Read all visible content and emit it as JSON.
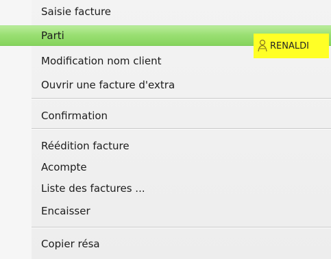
{
  "menu": {
    "items": [
      {
        "label": "Saisie facture"
      },
      {
        "label": "Parti"
      },
      {
        "label": "Modification nom client"
      },
      {
        "label": "Ouvrir une facture d'extra"
      },
      {
        "label": "Confirmation"
      },
      {
        "label": "Réédition facture"
      },
      {
        "label": "Acompte"
      },
      {
        "label": "Liste des factures ..."
      },
      {
        "label": "Encaisser"
      },
      {
        "label": "Copier résa"
      }
    ]
  },
  "tooltip": {
    "name": "RENALDI",
    "icon": "person-icon",
    "color": "#ffff26"
  },
  "highlight_color": "#9adf73"
}
